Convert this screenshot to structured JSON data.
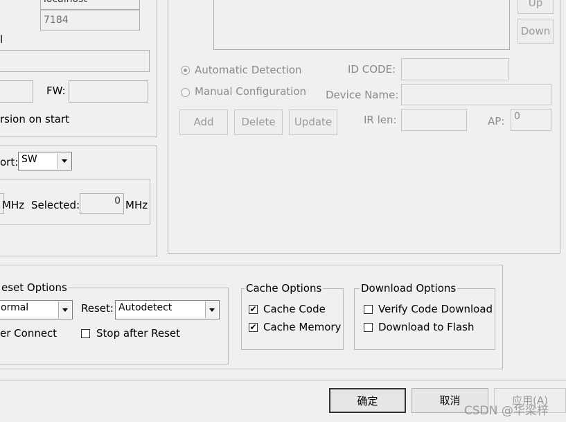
{
  "top_left": {
    "host_value": "localhost",
    "port_value": "7184",
    "fw_label": "FW:",
    "fw_value": "",
    "version_check_text": "rsion on start",
    "partial_label_l": "l"
  },
  "port_box": {
    "port_label": "ort:",
    "port_value": "SW",
    "mhz_label": "MHz",
    "selected_label": "Selected:",
    "selected_value": "0",
    "selected_unit": "MHz"
  },
  "jtag": {
    "up_label": "Up",
    "down_label": "Down",
    "auto_detect_label": "Automatic Detection",
    "manual_config_label": "Manual Configuration",
    "id_code_label": "ID CODE:",
    "id_code_value": "",
    "device_name_label": "Device Name:",
    "device_name_value": "",
    "ir_len_label": "IR len:",
    "ir_len_value": "",
    "ap_label": "AP:",
    "ap_value": "0",
    "add_label": "Add",
    "delete_label": "Delete",
    "update_label": "Update"
  },
  "reset_options": {
    "title": "eset Options",
    "mode_value": "ormal",
    "reset_label": "Reset:",
    "reset_value": "Autodetect",
    "connect_text": "er Connect",
    "stop_after_reset_label": "Stop after Reset"
  },
  "cache_options": {
    "title": "Cache Options",
    "cache_code_label": "Cache Code",
    "cache_memory_label": "Cache Memory",
    "checkmark": "✔"
  },
  "download_options": {
    "title": "Download Options",
    "verify_label": "Verify Code Download",
    "flash_label": "Download to Flash"
  },
  "dialog_buttons": {
    "ok_label": "确定",
    "cancel_label": "取消",
    "apply_label": "应用(A)"
  },
  "watermark": "CSDN @华梁梓"
}
